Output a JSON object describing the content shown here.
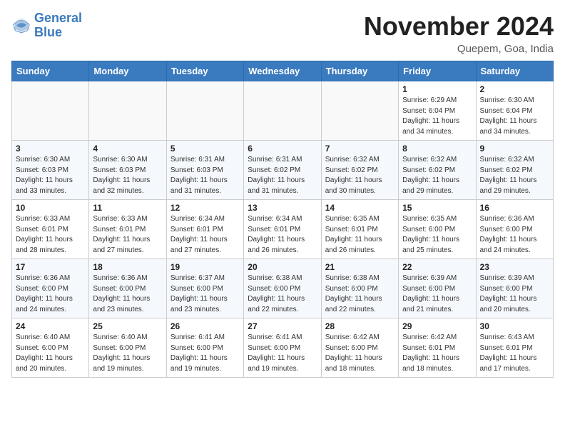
{
  "header": {
    "logo_line1": "General",
    "logo_line2": "Blue",
    "month_title": "November 2024",
    "location": "Quepem, Goa, India"
  },
  "weekdays": [
    "Sunday",
    "Monday",
    "Tuesday",
    "Wednesday",
    "Thursday",
    "Friday",
    "Saturday"
  ],
  "weeks": [
    [
      {
        "day": "",
        "info": ""
      },
      {
        "day": "",
        "info": ""
      },
      {
        "day": "",
        "info": ""
      },
      {
        "day": "",
        "info": ""
      },
      {
        "day": "",
        "info": ""
      },
      {
        "day": "1",
        "info": "Sunrise: 6:29 AM\nSunset: 6:04 PM\nDaylight: 11 hours\nand 34 minutes."
      },
      {
        "day": "2",
        "info": "Sunrise: 6:30 AM\nSunset: 6:04 PM\nDaylight: 11 hours\nand 34 minutes."
      }
    ],
    [
      {
        "day": "3",
        "info": "Sunrise: 6:30 AM\nSunset: 6:03 PM\nDaylight: 11 hours\nand 33 minutes."
      },
      {
        "day": "4",
        "info": "Sunrise: 6:30 AM\nSunset: 6:03 PM\nDaylight: 11 hours\nand 32 minutes."
      },
      {
        "day": "5",
        "info": "Sunrise: 6:31 AM\nSunset: 6:03 PM\nDaylight: 11 hours\nand 31 minutes."
      },
      {
        "day": "6",
        "info": "Sunrise: 6:31 AM\nSunset: 6:02 PM\nDaylight: 11 hours\nand 31 minutes."
      },
      {
        "day": "7",
        "info": "Sunrise: 6:32 AM\nSunset: 6:02 PM\nDaylight: 11 hours\nand 30 minutes."
      },
      {
        "day": "8",
        "info": "Sunrise: 6:32 AM\nSunset: 6:02 PM\nDaylight: 11 hours\nand 29 minutes."
      },
      {
        "day": "9",
        "info": "Sunrise: 6:32 AM\nSunset: 6:02 PM\nDaylight: 11 hours\nand 29 minutes."
      }
    ],
    [
      {
        "day": "10",
        "info": "Sunrise: 6:33 AM\nSunset: 6:01 PM\nDaylight: 11 hours\nand 28 minutes."
      },
      {
        "day": "11",
        "info": "Sunrise: 6:33 AM\nSunset: 6:01 PM\nDaylight: 11 hours\nand 27 minutes."
      },
      {
        "day": "12",
        "info": "Sunrise: 6:34 AM\nSunset: 6:01 PM\nDaylight: 11 hours\nand 27 minutes."
      },
      {
        "day": "13",
        "info": "Sunrise: 6:34 AM\nSunset: 6:01 PM\nDaylight: 11 hours\nand 26 minutes."
      },
      {
        "day": "14",
        "info": "Sunrise: 6:35 AM\nSunset: 6:01 PM\nDaylight: 11 hours\nand 26 minutes."
      },
      {
        "day": "15",
        "info": "Sunrise: 6:35 AM\nSunset: 6:00 PM\nDaylight: 11 hours\nand 25 minutes."
      },
      {
        "day": "16",
        "info": "Sunrise: 6:36 AM\nSunset: 6:00 PM\nDaylight: 11 hours\nand 24 minutes."
      }
    ],
    [
      {
        "day": "17",
        "info": "Sunrise: 6:36 AM\nSunset: 6:00 PM\nDaylight: 11 hours\nand 24 minutes."
      },
      {
        "day": "18",
        "info": "Sunrise: 6:36 AM\nSunset: 6:00 PM\nDaylight: 11 hours\nand 23 minutes."
      },
      {
        "day": "19",
        "info": "Sunrise: 6:37 AM\nSunset: 6:00 PM\nDaylight: 11 hours\nand 23 minutes."
      },
      {
        "day": "20",
        "info": "Sunrise: 6:38 AM\nSunset: 6:00 PM\nDaylight: 11 hours\nand 22 minutes."
      },
      {
        "day": "21",
        "info": "Sunrise: 6:38 AM\nSunset: 6:00 PM\nDaylight: 11 hours\nand 22 minutes."
      },
      {
        "day": "22",
        "info": "Sunrise: 6:39 AM\nSunset: 6:00 PM\nDaylight: 11 hours\nand 21 minutes."
      },
      {
        "day": "23",
        "info": "Sunrise: 6:39 AM\nSunset: 6:00 PM\nDaylight: 11 hours\nand 20 minutes."
      }
    ],
    [
      {
        "day": "24",
        "info": "Sunrise: 6:40 AM\nSunset: 6:00 PM\nDaylight: 11 hours\nand 20 minutes."
      },
      {
        "day": "25",
        "info": "Sunrise: 6:40 AM\nSunset: 6:00 PM\nDaylight: 11 hours\nand 19 minutes."
      },
      {
        "day": "26",
        "info": "Sunrise: 6:41 AM\nSunset: 6:00 PM\nDaylight: 11 hours\nand 19 minutes."
      },
      {
        "day": "27",
        "info": "Sunrise: 6:41 AM\nSunset: 6:00 PM\nDaylight: 11 hours\nand 19 minutes."
      },
      {
        "day": "28",
        "info": "Sunrise: 6:42 AM\nSunset: 6:00 PM\nDaylight: 11 hours\nand 18 minutes."
      },
      {
        "day": "29",
        "info": "Sunrise: 6:42 AM\nSunset: 6:01 PM\nDaylight: 11 hours\nand 18 minutes."
      },
      {
        "day": "30",
        "info": "Sunrise: 6:43 AM\nSunset: 6:01 PM\nDaylight: 11 hours\nand 17 minutes."
      }
    ]
  ]
}
